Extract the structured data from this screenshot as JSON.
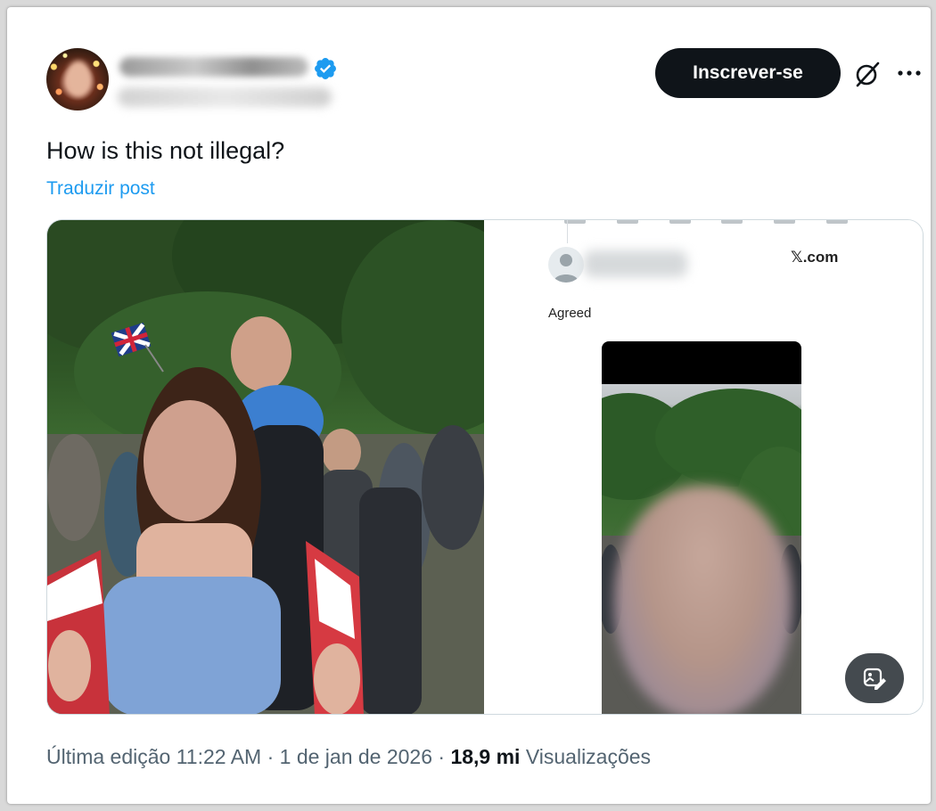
{
  "post": {
    "text": "How is this not illegal?",
    "translate_label": "Traduzir post"
  },
  "header": {
    "subscribe_label": "Inscrever-se"
  },
  "embedded_tweet": {
    "source": "𝕏.com",
    "text": "Agreed"
  },
  "meta": {
    "edited": "Última edição 11:22 AM · 1 de jan de 2026 · ",
    "views_count": "18,9 mi",
    "views_label": " Visualizações"
  },
  "colors": {
    "accent": "#1d9bf0",
    "text": "#0f1419",
    "secondary": "#536471"
  },
  "icons": [
    "verified-badge-icon",
    "grok-icon",
    "more-icon",
    "edit-image-icon"
  ]
}
